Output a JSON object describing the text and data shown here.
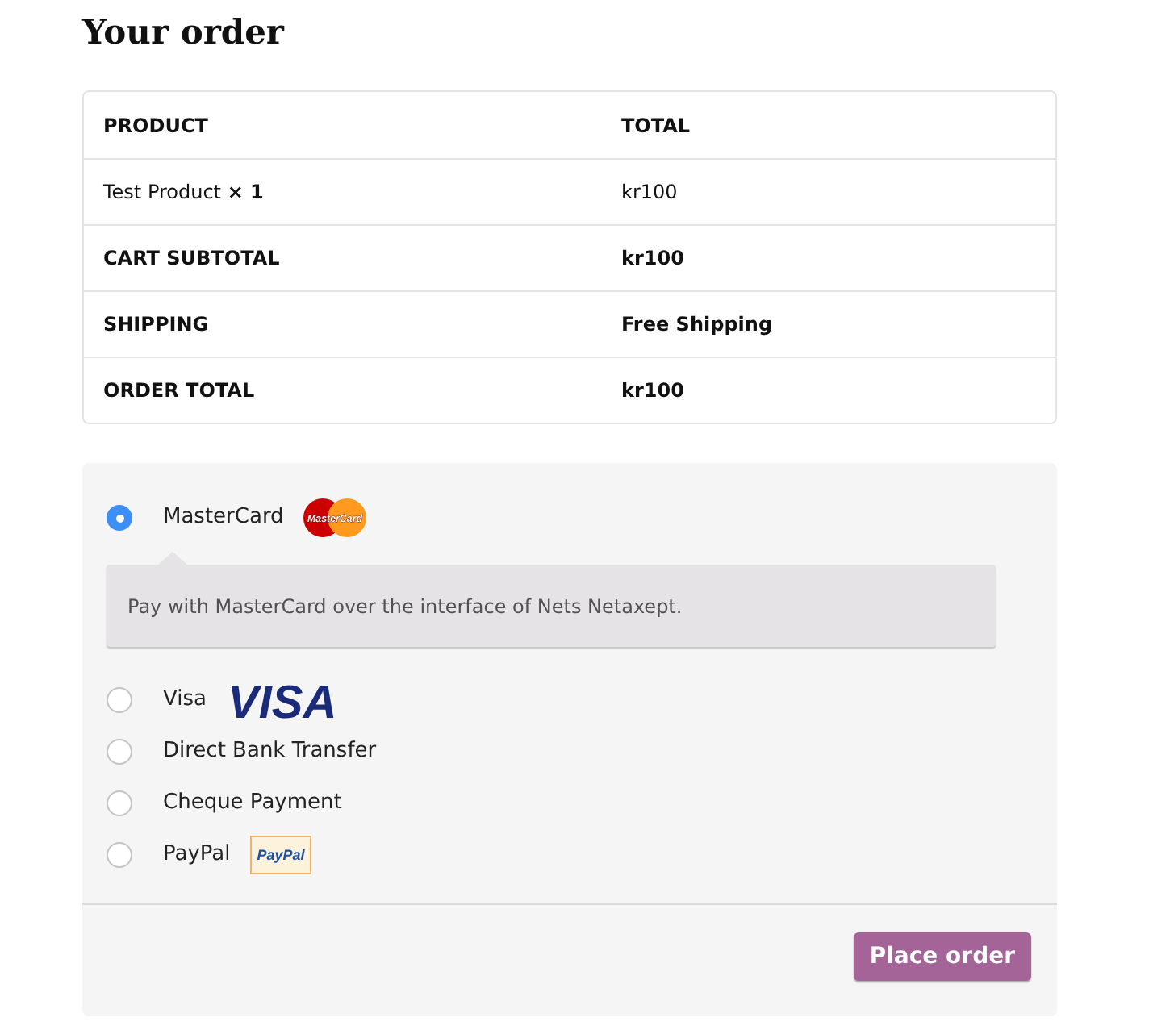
{
  "title": "Your order",
  "table": {
    "columns": [
      "PRODUCT",
      "TOTAL"
    ],
    "rows": [
      {
        "kind": "item",
        "label": "Test Product **× 1**",
        "value": "kr100"
      },
      {
        "kind": "summary",
        "label": "CART SUBTOTAL",
        "value": "kr100"
      },
      {
        "kind": "summary",
        "label": "SHIPPING",
        "value": "Free Shipping"
      },
      {
        "kind": "summary",
        "label": "ORDER TOTAL",
        "value": "kr100"
      }
    ]
  },
  "payment_methods": [
    {
      "label": "MasterCard",
      "selected": true,
      "logo": {
        "kind": "mastercard",
        "text": "MasterCard"
      },
      "description": "Pay with MasterCard over the interface of Nets Netaxept."
    },
    {
      "label": "Visa",
      "selected": false,
      "logo": {
        "kind": "visa",
        "text": "VISA"
      }
    },
    {
      "label": "Direct Bank Transfer",
      "selected": false
    },
    {
      "label": "Cheque Payment",
      "selected": false
    },
    {
      "label": "PayPal",
      "selected": false,
      "logo": {
        "kind": "paypal",
        "text": "PayPal"
      }
    }
  ],
  "place_order_button": "Place order"
}
